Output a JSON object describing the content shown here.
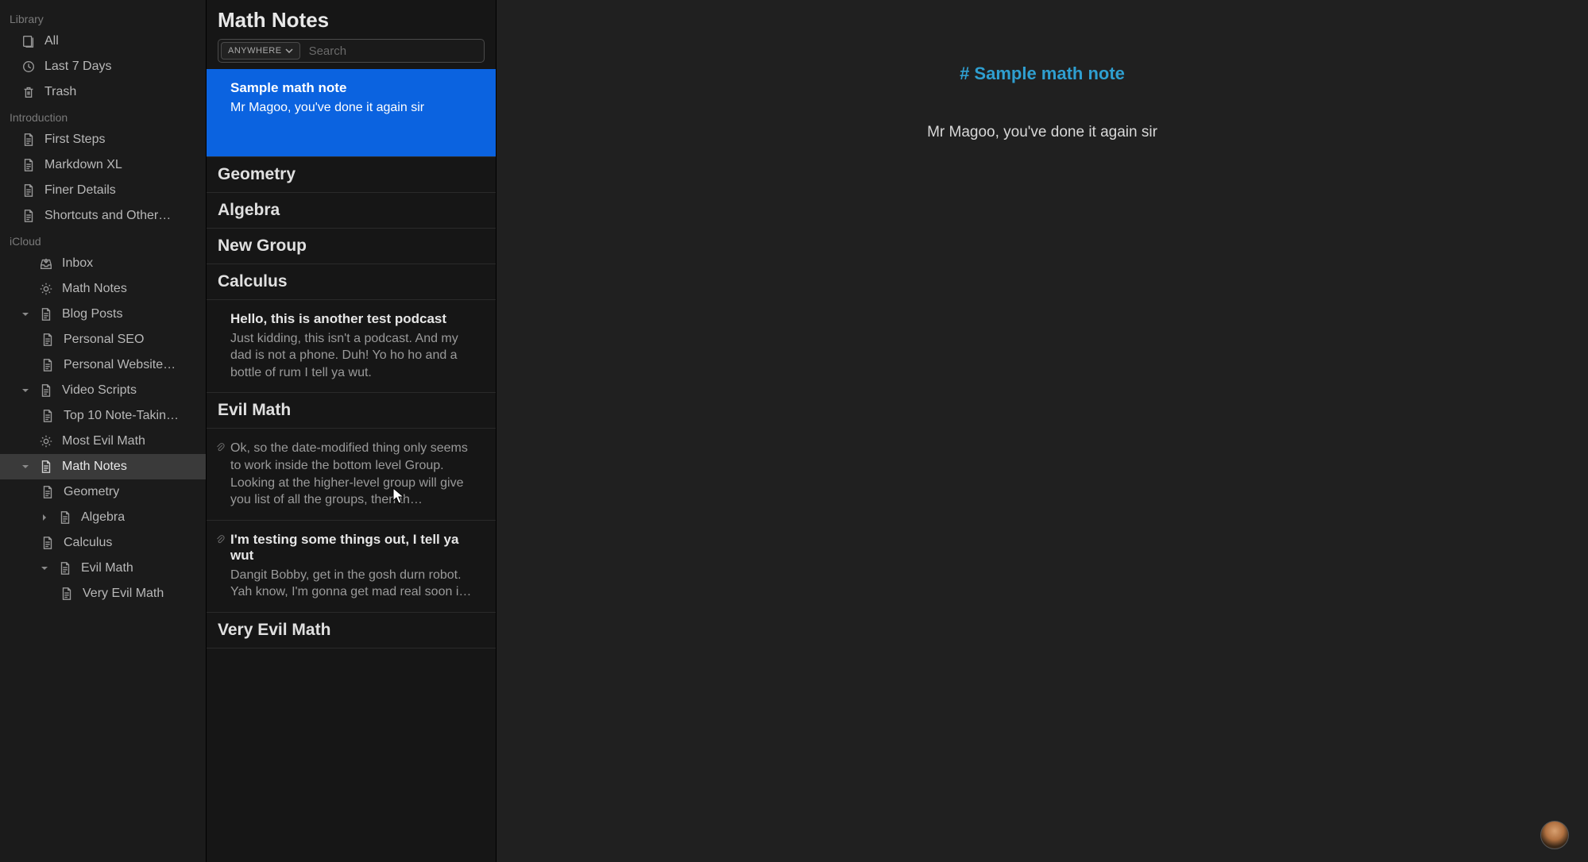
{
  "sidebar": {
    "sections": [
      {
        "title": "Library",
        "items": [
          {
            "name": "all",
            "icon": "stack",
            "label": "All",
            "indent": 1
          },
          {
            "name": "last-7-days",
            "icon": "clock",
            "label": "Last 7 Days",
            "indent": 1
          },
          {
            "name": "trash",
            "icon": "trash",
            "label": "Trash",
            "indent": 1
          }
        ]
      },
      {
        "title": "Introduction",
        "items": [
          {
            "name": "first-steps",
            "icon": "doc",
            "label": "First Steps",
            "indent": 1
          },
          {
            "name": "markdown-xl",
            "icon": "doc",
            "label": "Markdown XL",
            "indent": 1
          },
          {
            "name": "finer-details",
            "icon": "doc",
            "label": "Finer Details",
            "indent": 1
          },
          {
            "name": "shortcuts",
            "icon": "doc",
            "label": "Shortcuts and Other…",
            "indent": 1
          }
        ]
      },
      {
        "title": "iCloud",
        "items": [
          {
            "name": "inbox",
            "icon": "inbox",
            "label": "Inbox",
            "indent": 1
          },
          {
            "name": "math-notes-filter",
            "icon": "gear",
            "label": "Math Notes",
            "indent": 1
          },
          {
            "name": "blog-posts",
            "icon": "doc",
            "label": "Blog Posts",
            "indent": 1,
            "disclosure": "down"
          },
          {
            "name": "personal-seo",
            "icon": "doc",
            "label": "Personal SEO",
            "indent": 2
          },
          {
            "name": "personal-website",
            "icon": "doc",
            "label": "Personal Website…",
            "indent": 2
          },
          {
            "name": "video-scripts",
            "icon": "doc",
            "label": "Video Scripts",
            "indent": 1,
            "disclosure": "down"
          },
          {
            "name": "top-10-note",
            "icon": "doc",
            "label": "Top 10 Note-Takin…",
            "indent": 2
          },
          {
            "name": "most-evil-math",
            "icon": "gear",
            "label": "Most Evil Math",
            "indent": 1
          },
          {
            "name": "math-notes-group",
            "icon": "doc",
            "label": "Math Notes",
            "indent": 1,
            "disclosure": "down",
            "selected": true
          },
          {
            "name": "geometry",
            "icon": "doc",
            "label": "Geometry",
            "indent": 2
          },
          {
            "name": "algebra",
            "icon": "doc",
            "label": "Algebra",
            "indent": 2,
            "disclosure": "right"
          },
          {
            "name": "calculus",
            "icon": "doc",
            "label": "Calculus",
            "indent": 2
          },
          {
            "name": "evil-math",
            "icon": "doc",
            "label": "Evil Math",
            "indent": 2,
            "disclosure": "down"
          },
          {
            "name": "very-evil-math",
            "icon": "doc",
            "label": "Very Evil Math",
            "indent": 3
          }
        ]
      }
    ]
  },
  "note_list": {
    "title": "Math Notes",
    "search_scope": "ANYWHERE",
    "search_placeholder": "Search",
    "entries": [
      {
        "kind": "note",
        "name": "sample-math-note",
        "title": "Sample math note",
        "preview": "Mr Magoo, you've done it again sir",
        "selected": true,
        "tall": true
      },
      {
        "kind": "group",
        "name": "geometry-group",
        "title": "Geometry"
      },
      {
        "kind": "group",
        "name": "algebra-group",
        "title": "Algebra"
      },
      {
        "kind": "group",
        "name": "new-group",
        "title": "New Group"
      },
      {
        "kind": "group",
        "name": "calculus-group",
        "title": "Calculus"
      },
      {
        "kind": "note",
        "name": "test-podcast-note",
        "title": "Hello, this is another test podcast",
        "preview": "Just kidding, this isn't a podcast. And my dad is not a phone. Duh! Yo ho ho and a bottle of rum I tell ya wut."
      },
      {
        "kind": "group",
        "name": "evil-math-group",
        "title": "Evil Math"
      },
      {
        "kind": "note",
        "name": "date-modified-note",
        "title": "",
        "preview": "Ok, so the date-modified thing only seems to work inside the bottom level Group. Looking at the higher-level group will give you list of all the groups, then th…",
        "attachment": true
      },
      {
        "kind": "note",
        "name": "testing-note",
        "title": "I'm testing some things out, I tell ya wut",
        "preview": "Dangit Bobby, get in the gosh durn robot. Yah know, I'm gonna get mad real soon i…",
        "attachment": true
      },
      {
        "kind": "group",
        "name": "very-evil-math-group",
        "title": "Very Evil Math"
      }
    ]
  },
  "editor": {
    "title": "# Sample math note",
    "body": "Mr Magoo, you've done it again sir"
  }
}
